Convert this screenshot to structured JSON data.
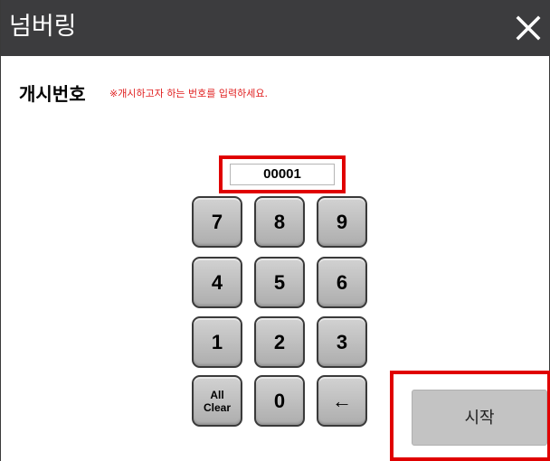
{
  "dialog": {
    "title": "넘버링",
    "close_icon": "close-icon"
  },
  "form": {
    "label": "개시번호",
    "hint": "※개시하고자 하는 번호를 입력하세요.",
    "number_value": "00001"
  },
  "keypad": {
    "keys": [
      "7",
      "8",
      "9",
      "4",
      "5",
      "6",
      "1",
      "2",
      "3"
    ],
    "clear_line1": "All",
    "clear_line2": "Clear",
    "zero": "0",
    "backspace": "←"
  },
  "actions": {
    "start_label": "시작"
  },
  "colors": {
    "titlebar": "#3c3c3e",
    "highlight": "#e00000",
    "hint": "#e02020",
    "key_face": "#c0c0c0",
    "start_button": "#c3c3c3"
  }
}
